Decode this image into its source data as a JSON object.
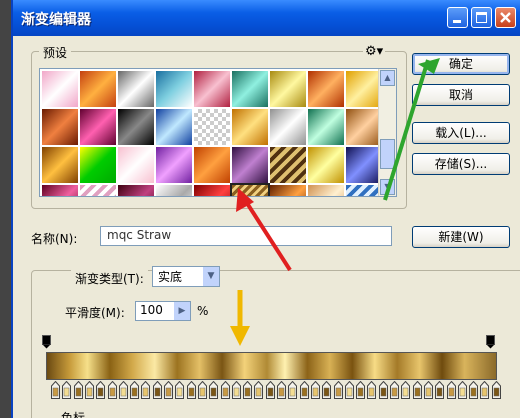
{
  "window": {
    "title": "渐变编辑器"
  },
  "presets": {
    "label": "预设",
    "gear": "⚙▾",
    "swatches": [
      [
        "#f1a6c8",
        "#c44010",
        "#b8b8b8",
        "#7ecfe0",
        "#e07890",
        "#48c0b0",
        "#e8d84a",
        "#ff7010",
        "#fff0a0"
      ],
      [
        "#a04020",
        "#c02070",
        "#222",
        "#70b0e8",
        "#e8d0d0",
        "#e0a030",
        "#cccccc",
        "#e04070",
        "#d0c0a0"
      ],
      [
        "#c88020",
        "#30c020",
        "#f0d0e0",
        "#d070c0",
        "#f08030",
        "#884488",
        "#c09040",
        "#f8e070",
        "#7080c0"
      ],
      [
        "#a02060",
        "#c070a0",
        "#800040",
        "#cfcfcf",
        "#d02020",
        "#c8a050",
        "#c06010",
        "#e8c090",
        "#90c0e8"
      ]
    ],
    "swatch_styles": [
      [
        "linear-gradient(135deg,#f1a6c8,#fff,#f1a6c8)",
        "linear-gradient(135deg,#c44010,#ffb040,#c44010)",
        "linear-gradient(135deg,#666,#fff,#666)",
        "linear-gradient(135deg,#1a6fa0,#7ecfe0,#fff)",
        "linear-gradient(135deg,#b02040,#f8c0d0,#b02040)",
        "linear-gradient(135deg,#1a7060,#8ff0e0,#1a7060)",
        "linear-gradient(135deg,#a88a10,#fff8a0,#a88a10)",
        "linear-gradient(135deg,#b03000,#ffb060,#b03000)",
        "linear-gradient(135deg,#e0a000,#fff0a0,#e0a000)"
      ],
      [
        "linear-gradient(135deg,#6a1a00,#f08040,#6a1a00)",
        "linear-gradient(135deg,#600030,#ff60b0,#600030)",
        "linear-gradient(135deg,#000,#888,#000)",
        "linear-gradient(135deg,#1040a0,#c0e8ff,#1040a0)",
        "repeating-conic-gradient(#ccc 0 25%,#fff 0 50%) 0 0/8px 8px",
        "linear-gradient(135deg,#c07000,#ffe080,#c07000)",
        "linear-gradient(135deg,#909090,#fff,#909090)",
        "linear-gradient(135deg,#107050,#c0ffe0,#107050)",
        "linear-gradient(135deg,#905010,#ffd0a0,#905010)"
      ],
      [
        "linear-gradient(135deg,#804000,#ffc040,#804000)",
        "linear-gradient(135deg,#ff0,#0c0,#0a0)",
        "linear-gradient(135deg,#f8c0d0,#fff,#f8c0d0)",
        "linear-gradient(135deg,#7020a0,#f0a0ff,#7020a0)",
        "linear-gradient(135deg,#c04000,#ffa040,#c04000)",
        "linear-gradient(135deg,#301040,#c080d0,#301040)",
        "repeating-linear-gradient(135deg,#503010 0 4px,#e0c070 4px 8px)",
        "linear-gradient(135deg,#c09000,#ffffa0,#c09000)",
        "linear-gradient(135deg,#101050,#8090ff,#101050)"
      ],
      [
        "linear-gradient(135deg,#600020,#f060a0,#600020)",
        "repeating-linear-gradient(135deg,#e0a0c0 0 4px,#fff 4px 8px)",
        "linear-gradient(135deg,#400010,#c04080,#400010)",
        "linear-gradient(135deg,#fff,#aaa,#fff)",
        "linear-gradient(135deg,#800000,#ff4040,#800000)",
        "repeating-linear-gradient(135deg,#8a6020 0 3px,#f0d080 3px 6px)",
        "linear-gradient(135deg,#602000,#ffa040,#602000)",
        "linear-gradient(135deg,#d09050,#fff0d0,#d09050)",
        "repeating-linear-gradient(135deg,#3070c0 0 4px,#e0f0ff 4px 8px)"
      ]
    ]
  },
  "buttons": {
    "ok": "确定",
    "cancel": "取消",
    "load": "载入(L)...",
    "save": "存储(S)...",
    "new": "新建(W)"
  },
  "name": {
    "label": "名称(N):",
    "value": "mqc Straw"
  },
  "gradient_type": {
    "label": "渐变类型(T):",
    "value": "实底"
  },
  "smoothness": {
    "label": "平滑度(M):",
    "value": "100",
    "unit": "%"
  },
  "section_below": "色标"
}
